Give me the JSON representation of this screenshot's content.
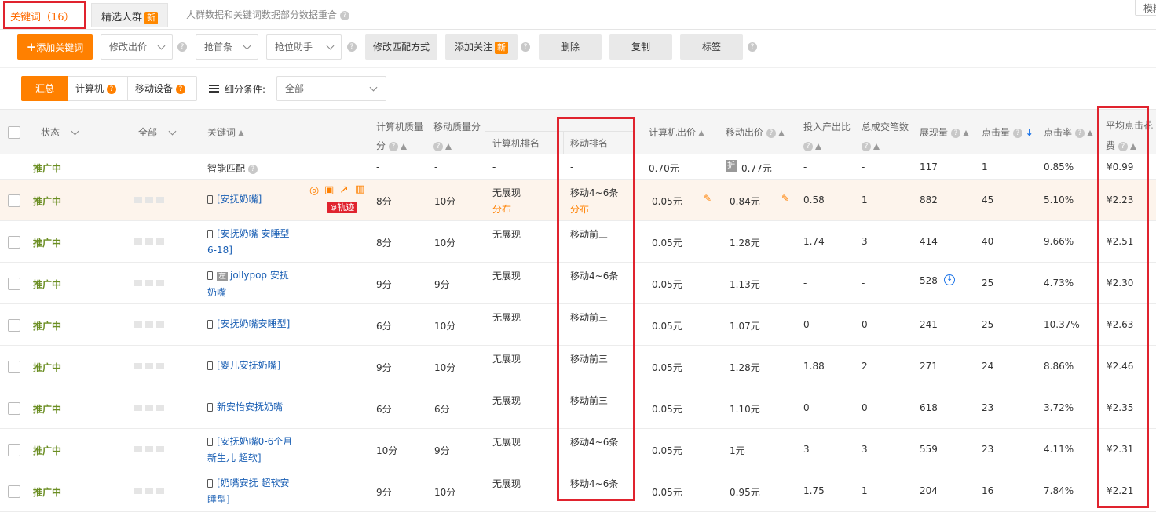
{
  "tabs": [
    {
      "label": "关键词（16）",
      "active": true
    },
    {
      "label": "精选人群",
      "badge": "新"
    }
  ],
  "notice": "人群数据和关键词数据部分数据重合",
  "corner_text": "模糊",
  "toolbar": {
    "add": "添加关键词",
    "modify_bid": "修改出价",
    "grab_first": "抢首条",
    "grab_helper": "抢位助手",
    "modify_match": "修改匹配方式",
    "add_follow": "添加关注",
    "add_follow_badge": "新",
    "delete": "删除",
    "copy": "复制",
    "tag": "标签"
  },
  "filter": {
    "summary": "汇总",
    "pc": "计算机",
    "mobile": "移动设备",
    "cond_label": "细分条件:",
    "cond_value": "全部"
  },
  "headers": {
    "status": "状态",
    "all": "全部",
    "keyword": "关键词",
    "pc_quality_1": "计算机质量",
    "pc_quality_2": "分",
    "mob_quality": "移动质量分",
    "pc_rank": "计算机排名",
    "mob_rank": "移动排名",
    "pc_bid": "计算机出价",
    "mob_bid": "移动出价",
    "roi": "投入产出比",
    "deals": "总成交笔数",
    "impressions": "展现量",
    "clicks": "点击量",
    "ctr": "点击率",
    "cpc_1": "平均点击花",
    "cpc_2": "费"
  },
  "smart": {
    "label": "智能匹配",
    "pcq": "-",
    "mq": "-",
    "pcr": "-",
    "mr": "-",
    "pcb": "0.70元",
    "mb_badge": "折",
    "mb": "0.77元",
    "roi": "-",
    "deals": "-",
    "imp": "117",
    "clicks": "1",
    "ctr": "0.85%",
    "cpc": "¥0.99"
  },
  "track_label": "轨迹",
  "rows": [
    {
      "status": "推广中",
      "keyword": "[安抚奶嘴]",
      "pcq": "8分",
      "mq": "10分",
      "pcr": "无展现",
      "pcr2": "分布",
      "mr": "移动4~6条",
      "mr2": "分布",
      "pcb": "0.05元",
      "mb": "0.84元",
      "roi": "0.58",
      "deals": "1",
      "imp": "882",
      "clicks": "45",
      "ctr": "5.10%",
      "cpc": "¥2.23"
    },
    {
      "status": "推广中",
      "keyword": "[安抚奶嘴 安睡型 6-18]",
      "pcq": "8分",
      "mq": "10分",
      "pcr": "无展现",
      "mr": "移动前三",
      "pcb": "0.05元",
      "mb": "1.28元",
      "roi": "1.74",
      "deals": "3",
      "imp": "414",
      "clicks": "40",
      "ctr": "9.66%",
      "cpc": "¥2.51"
    },
    {
      "status": "推广中",
      "keyword_badge": "左",
      "keyword": "jollypop 安抚奶嘴",
      "pcq": "9分",
      "mq": "9分",
      "pcr": "无展现",
      "mr": "移动4~6条",
      "pcb": "0.05元",
      "mb": "1.13元",
      "roi": "-",
      "deals": "-",
      "imp": "528",
      "clicks": "25",
      "ctr": "4.73%",
      "cpc": "¥2.30"
    },
    {
      "status": "推广中",
      "keyword": "[安抚奶嘴安睡型]",
      "pcq": "6分",
      "mq": "10分",
      "pcr": "无展现",
      "mr": "移动前三",
      "pcb": "0.05元",
      "mb": "1.07元",
      "roi": "0",
      "deals": "0",
      "imp": "241",
      "clicks": "25",
      "ctr": "10.37%",
      "cpc": "¥2.63"
    },
    {
      "status": "推广中",
      "keyword": "[婴儿安抚奶嘴]",
      "pcq": "9分",
      "mq": "10分",
      "pcr": "无展现",
      "mr": "移动前三",
      "pcb": "0.05元",
      "mb": "1.28元",
      "roi": "1.88",
      "deals": "2",
      "imp": "271",
      "clicks": "24",
      "ctr": "8.86%",
      "cpc": "¥2.46"
    },
    {
      "status": "推广中",
      "keyword": "新安怡安抚奶嘴",
      "pcq": "6分",
      "mq": "6分",
      "pcr": "无展现",
      "mr": "移动前三",
      "pcb": "0.05元",
      "mb": "1.10元",
      "roi": "0",
      "deals": "0",
      "imp": "618",
      "clicks": "23",
      "ctr": "3.72%",
      "cpc": "¥2.35"
    },
    {
      "status": "推广中",
      "keyword": "[安抚奶嘴0-6个月 新生儿 超软]",
      "pcq": "10分",
      "mq": "9分",
      "pcr": "无展现",
      "mr": "移动4~6条",
      "pcb": "0.05元",
      "mb": "1元",
      "roi": "3",
      "deals": "3",
      "imp": "559",
      "clicks": "23",
      "ctr": "4.11%",
      "cpc": "¥2.31"
    },
    {
      "status": "推广中",
      "keyword": "[奶嘴安抚 超软安睡型]",
      "pcq": "9分",
      "mq": "10分",
      "pcr": "无展现",
      "mr": "移动4~6条",
      "pcb": "0.05元",
      "mb": "0.95元",
      "roi": "1.75",
      "deals": "1",
      "imp": "204",
      "clicks": "16",
      "ctr": "7.84%",
      "cpc": "¥2.21"
    }
  ]
}
